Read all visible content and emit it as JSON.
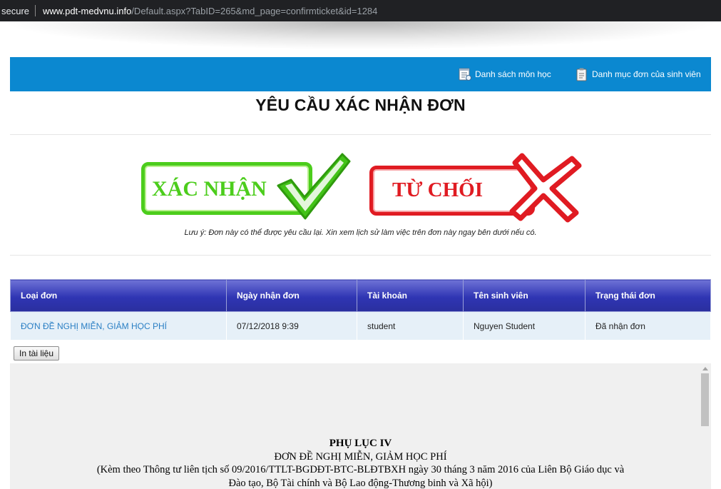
{
  "browser": {
    "security_label": "secure",
    "url_host": "www.pdt-medvnu.info",
    "url_path": "/Default.aspx?TabID=265&md_page=confirmticket&id=1284"
  },
  "topbar": {
    "course_list": {
      "label": "Danh sách môn học",
      "icon": "list-document-icon"
    },
    "student_requests": {
      "label": "Danh mục đơn của sinh viên",
      "icon": "clipboard-icon"
    }
  },
  "page_title": "YÊU CẦU XÁC NHẬN ĐƠN",
  "actions": {
    "confirm": {
      "label": "XÁC NHẬN",
      "icon": "checkmark-icon",
      "color": "#4ccd1c"
    },
    "reject": {
      "label": "TỪ CHỐI",
      "icon": "x-mark-icon",
      "color": "#e01b22"
    }
  },
  "note": "Lưu ý: Đơn này có thể được yêu cầu lại. Xin xem lịch sử làm việc trên đơn này ngay bên dưới nếu có.",
  "table": {
    "headers": [
      "Loại đơn",
      "Ngày nhận đơn",
      "Tài khoản",
      "Tên sinh viên",
      "Trạng thái đơn"
    ],
    "rows": [
      [
        "ĐƠN ĐỀ NGHỊ MIỄN, GIẢM HỌC PHÍ",
        "07/12/2018 9:39",
        "student",
        "Nguyen Student",
        "Đã nhận đơn"
      ]
    ]
  },
  "print_button": "In tài liệu",
  "document": {
    "heading": "PHỤ LỤC IV",
    "subtitle": "ĐƠN ĐỀ NGHỊ MIỄN, GIẢM HỌC PHÍ",
    "line1": "(Kèm theo Thông tư liên tịch số 09/2016/TTLT-BGDĐT-BTC-BLĐTBXH ngày 30 tháng 3 năm 2016 của Liên Bộ Giáo dục và",
    "line2": "Đào tạo, Bộ Tài chính và Bộ Lao động-Thương binh và Xã hội)"
  }
}
